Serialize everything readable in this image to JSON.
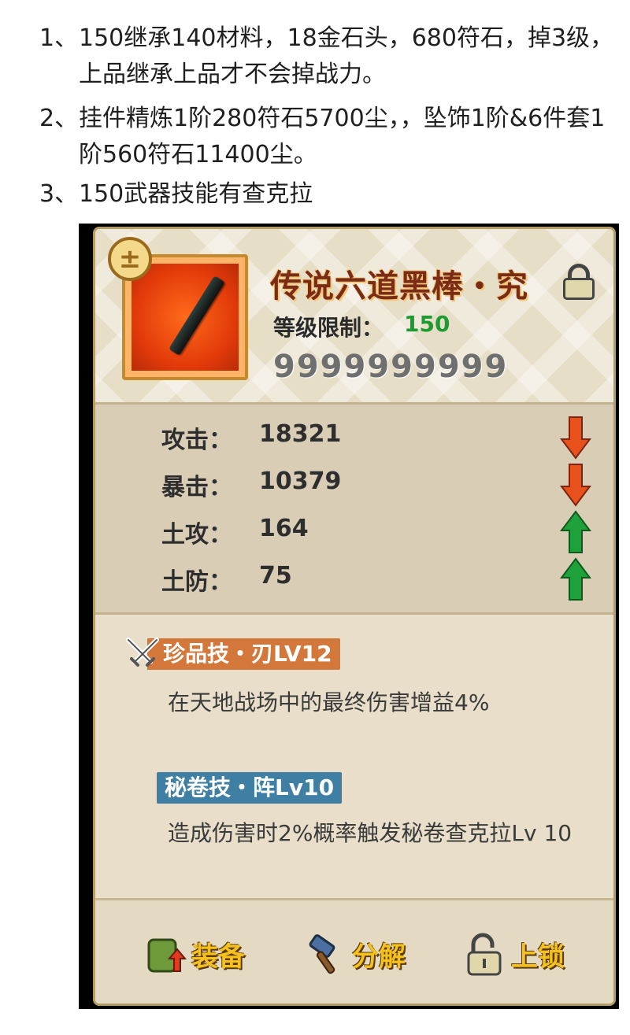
{
  "notes": [
    {
      "num": "1、",
      "text": "150继承140材料，18金石头，680符石，掉3级，上品继承上品才不会掉战力。"
    },
    {
      "num": "2、",
      "text": "挂件精炼1阶280符石5700尘，，坠饰1阶&6件套1阶560符石11400尘。"
    },
    {
      "num": "3、",
      "text": "150武器技能有查克拉"
    }
  ],
  "item": {
    "name": "传说六道黑棒・究",
    "level_label": "等级限制：",
    "level_value": "150",
    "gems": "9999999999"
  },
  "stats": [
    {
      "label": "攻击：",
      "value": "18321",
      "trend": "down"
    },
    {
      "label": "暴击：",
      "value": "10379",
      "trend": "down"
    },
    {
      "label": "土攻：",
      "value": "164",
      "trend": "up"
    },
    {
      "label": "土防：",
      "value": "75",
      "trend": "up"
    }
  ],
  "skills": [
    {
      "tag": "珍品技・刃LV12",
      "desc": "在天地战场中的最终伤害增益4%"
    },
    {
      "tag": "秘卷技・阵Lv10",
      "desc": "造成伤害时2%概率触发秘卷查克拉Lv 10"
    }
  ],
  "buttons": {
    "equip": "装备",
    "split": "分解",
    "lock": "上锁"
  },
  "colors": {
    "down_arrow": "#e8501c",
    "up_arrow": "#1ea13a",
    "gold_text": "#f5c21d",
    "title": "#7a2c16"
  }
}
